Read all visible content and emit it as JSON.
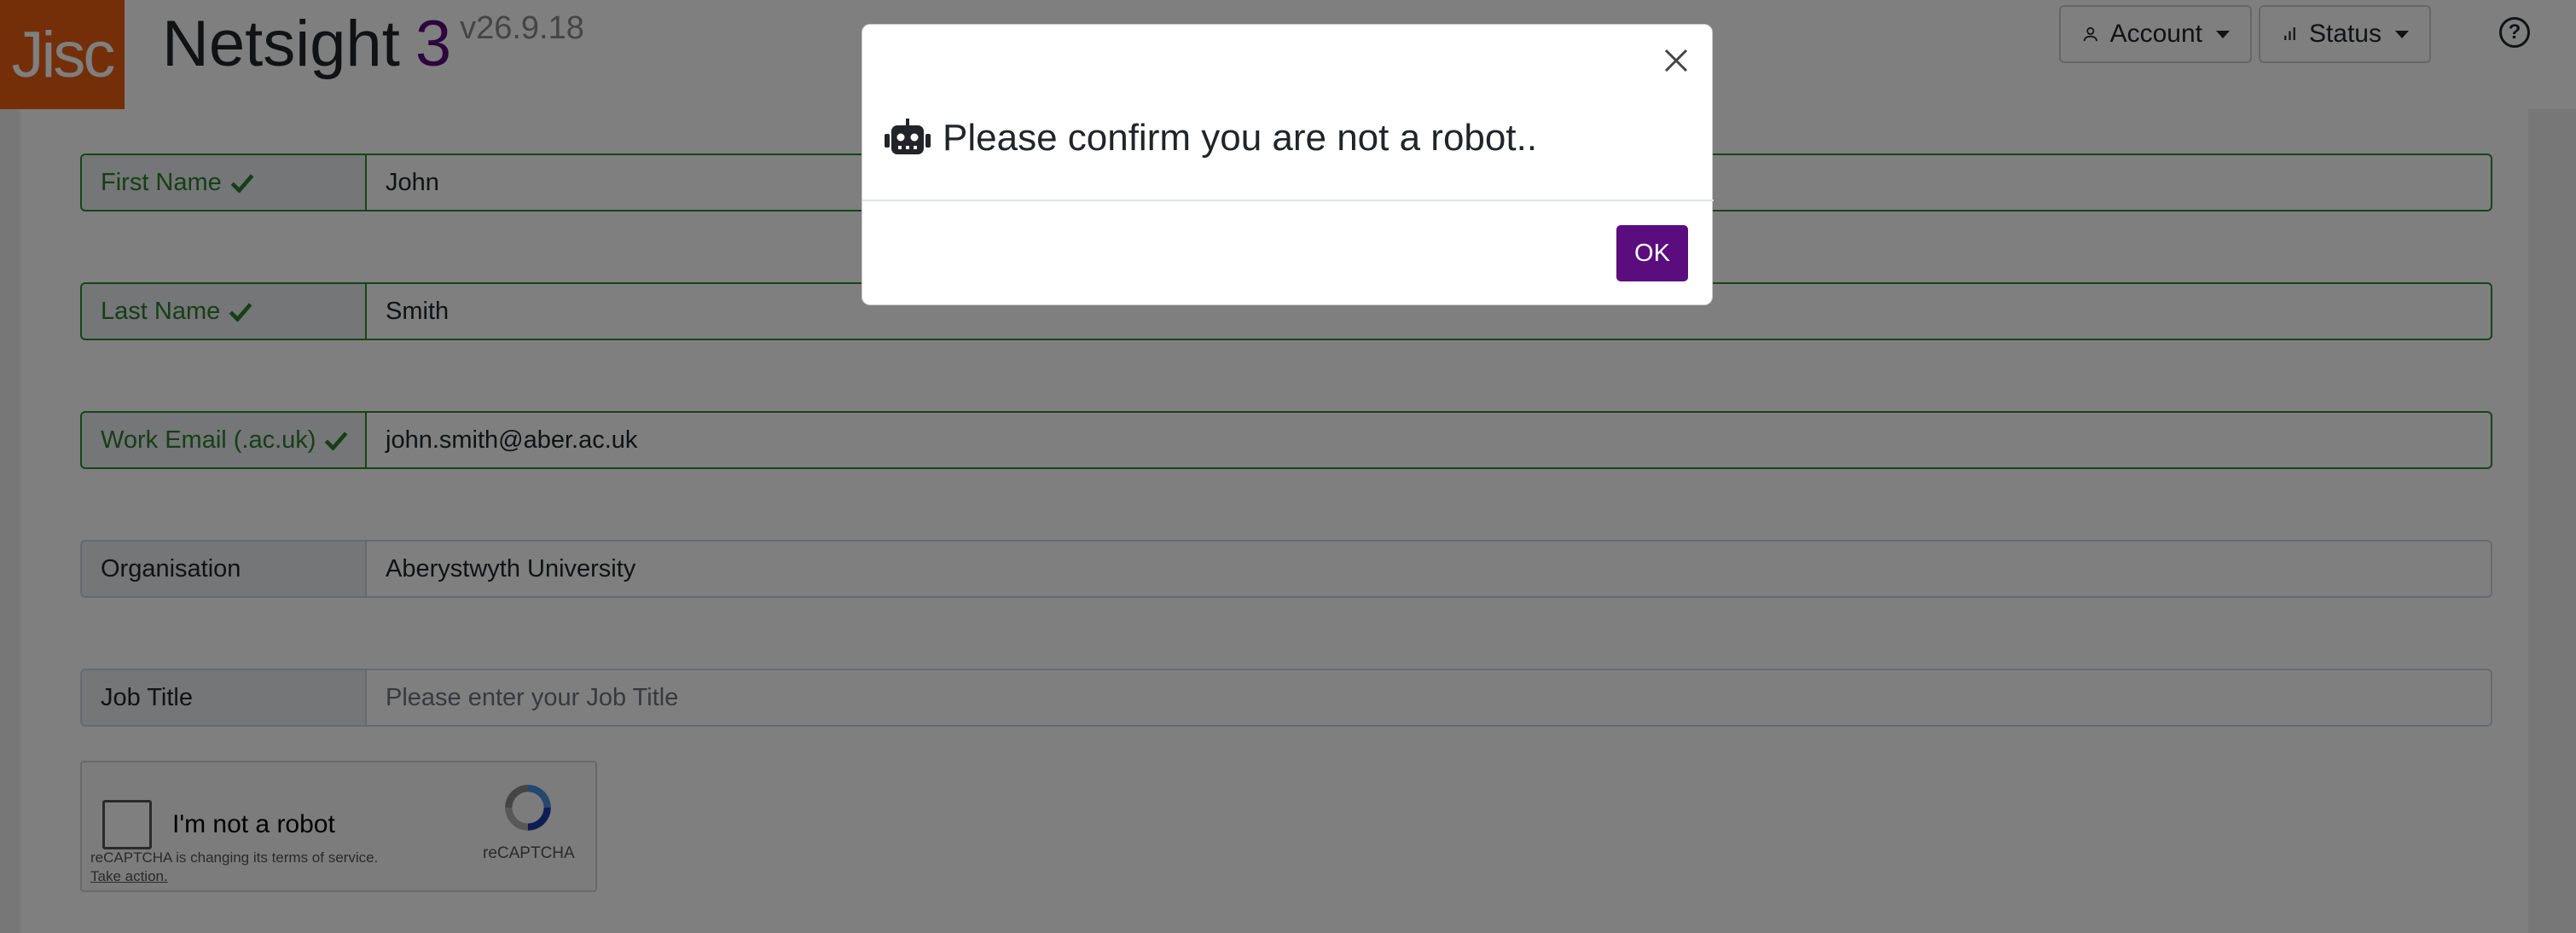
{
  "header": {
    "logo_text": "Jisc",
    "app_name": "Netsight",
    "app_number": "3",
    "version": "v26.9.18",
    "account_label": "Account",
    "status_label": "Status",
    "help_icon": "help-circle-icon"
  },
  "form": {
    "first_name": {
      "label": "First Name",
      "value": "John",
      "valid": true
    },
    "last_name": {
      "label": "Last Name",
      "value": "Smith",
      "valid": true
    },
    "work_email": {
      "label": "Work Email (.ac.uk)",
      "value": "john.smith@aber.ac.uk",
      "valid": true
    },
    "organisation": {
      "label": "Organisation",
      "value": "Aberystwyth University"
    },
    "job_title": {
      "label": "Job Title",
      "value": "",
      "placeholder": "Please enter your Job Title"
    }
  },
  "recaptcha": {
    "checkbox_label": "I'm not a robot",
    "notice": "reCAPTCHA is changing its terms of service.",
    "notice_link": "Take action.",
    "brand": "reCAPTCHA"
  },
  "modal": {
    "title": "Please confirm you are not a robot..",
    "icon": "robot-icon",
    "ok_label": "OK"
  },
  "colors": {
    "brand_orange": "#e85e13",
    "brand_purple": "#5b0d7e",
    "valid_green": "#2e7d2e"
  }
}
